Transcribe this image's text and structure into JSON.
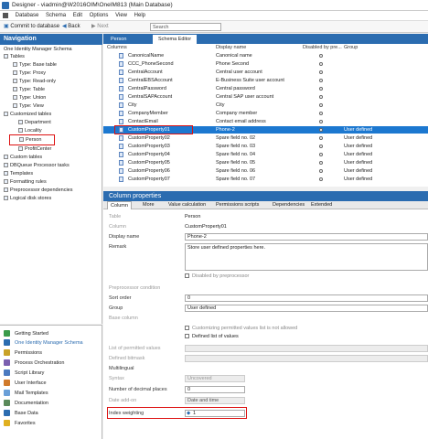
{
  "app": {
    "title": "Designer - viadmin@W2016OIM\\OneIM813 (Main Database)"
  },
  "menu": [
    "Database",
    "Schema",
    "Edit",
    "Options",
    "View",
    "Help"
  ],
  "toolbar": {
    "commit": "Commit to database",
    "back": "Back",
    "next": "Next",
    "search_placeholder": "Search"
  },
  "nav": {
    "header": "Navigation",
    "root": "One Identity Manager Schema",
    "tree": [
      "Tables",
      "Type: Base table",
      "Type: Proxy",
      "Type: Read-only",
      "Type: Table",
      "Type: Union",
      "Type: View",
      "Customized tables",
      "Department",
      "Locality",
      "Person",
      "ProfitCenter",
      "Custom tables",
      "DBQueue Processor tasks",
      "Templates",
      "Formatting rules",
      "Preprocessor dependencies",
      "Logical disk stores"
    ],
    "list": [
      "Getting Started",
      "One Identity Manager Schema",
      "Permissions",
      "Process Orchestration",
      "Script Library",
      "User Interface",
      "Mail Templates",
      "Documentation",
      "Base Data",
      "Favorites"
    ]
  },
  "tabs": [
    "Person",
    "Schema Editor"
  ],
  "grid": {
    "headers": [
      "Columns",
      "Display name",
      "Disabled by pre...",
      "Group"
    ],
    "rows": [
      {
        "col": "CanonicalName",
        "disp": "Canonical name",
        "grp": ""
      },
      {
        "col": "CCC_PhoneSecond",
        "disp": "Phone Second",
        "grp": ""
      },
      {
        "col": "CentralAccount",
        "disp": "Central user account",
        "grp": ""
      },
      {
        "col": "CentralEBSAccount",
        "disp": "E-Business Suite user account",
        "grp": ""
      },
      {
        "col": "CentralPassword",
        "disp": "Central password",
        "grp": ""
      },
      {
        "col": "CentralSAPAccount",
        "disp": "Central SAP user account",
        "grp": ""
      },
      {
        "col": "City",
        "disp": "City",
        "grp": ""
      },
      {
        "col": "CompanyMember",
        "disp": "Company member",
        "grp": ""
      },
      {
        "col": "ContactEmail",
        "disp": "Contact email address",
        "grp": ""
      },
      {
        "col": "CustomProperty01",
        "disp": "Phone-2",
        "grp": "User defined"
      },
      {
        "col": "CustomProperty02",
        "disp": "Spare field no. 02",
        "grp": "User defined"
      },
      {
        "col": "CustomProperty03",
        "disp": "Spare field no. 03",
        "grp": "User defined"
      },
      {
        "col": "CustomProperty04",
        "disp": "Spare field no. 04",
        "grp": "User defined"
      },
      {
        "col": "CustomProperty05",
        "disp": "Spare field no. 05",
        "grp": "User defined"
      },
      {
        "col": "CustomProperty06",
        "disp": "Spare field no. 06",
        "grp": "User defined"
      },
      {
        "col": "CustomProperty07",
        "disp": "Spare field no. 07",
        "grp": "User defined"
      }
    ]
  },
  "props": {
    "header": "Column properties",
    "tabs": [
      "Column",
      "More",
      "Value calculation",
      "Permissions scripts",
      "Dependencies",
      "Extended"
    ],
    "table_label": "Table",
    "table": "Person",
    "column_label": "Column",
    "column": "CustomProperty01",
    "display_label": "Display name",
    "display": "Phone-2",
    "remark_label": "Remark",
    "remark": "Store user defined properties here.",
    "disabled_pre": "Disabled by preprocessor",
    "precond_label": "Preprocessor condition",
    "sort_label": "Sort order",
    "sort": "0",
    "group_label": "Group",
    "group": "User defined",
    "base_label": "Base column",
    "custom_perm": "Customizing permitted values list is not allowed",
    "defined_list": "Defined list of values",
    "list_label": "List of permitted values",
    "bitmask_label": "Defined bitmask",
    "multi_label": "Multilingual",
    "syntax_label": "Syntax",
    "syntax": "Uncovered",
    "decimals_label": "Number of decimal places",
    "decimals": "0",
    "dateadd_label": "Date add-on",
    "dateadd": "Date and time",
    "weight_label": "Index weighting",
    "weight": "1"
  },
  "colors": {
    "nav": "#2b6cb0",
    "selected": "#1c78d0",
    "highlight": "#d11111"
  }
}
